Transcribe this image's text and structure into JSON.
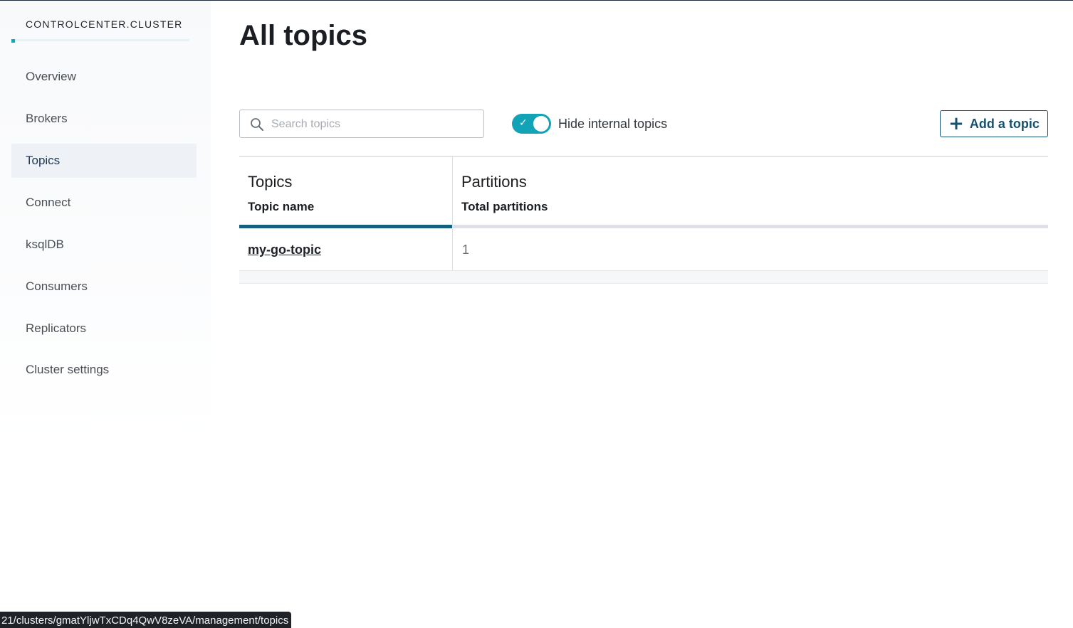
{
  "sidebar": {
    "cluster_name": "CONTROLCENTER.CLUSTER",
    "items": [
      {
        "label": "Overview",
        "active": false
      },
      {
        "label": "Brokers",
        "active": false
      },
      {
        "label": "Topics",
        "active": true
      },
      {
        "label": "Connect",
        "active": false
      },
      {
        "label": "ksqlDB",
        "active": false
      },
      {
        "label": "Consumers",
        "active": false
      },
      {
        "label": "Replicators",
        "active": false
      },
      {
        "label": "Cluster settings",
        "active": false
      }
    ]
  },
  "main": {
    "title": "All topics",
    "search": {
      "placeholder": "Search topics",
      "value": ""
    },
    "toggle": {
      "label": "Hide internal topics",
      "checked": true,
      "check_glyph": "✓"
    },
    "add_button": {
      "label": "Add a topic",
      "icon": "plus-icon",
      "glyph": "+"
    },
    "table": {
      "columns": [
        {
          "title": "Topics",
          "subtitle": "Topic name"
        },
        {
          "title": "Partitions",
          "subtitle": "Total partitions"
        }
      ],
      "rows": [
        {
          "topic": "my-go-topic",
          "partitions": "1"
        }
      ]
    }
  },
  "status_bar": {
    "url": "21/clusters/gmatYljwTxCDq4QwV8zeVA/management/topics"
  },
  "colors": {
    "accent_teal": "#12a3b6",
    "primary_blue": "#15506f",
    "sort_active": "#15607f"
  }
}
